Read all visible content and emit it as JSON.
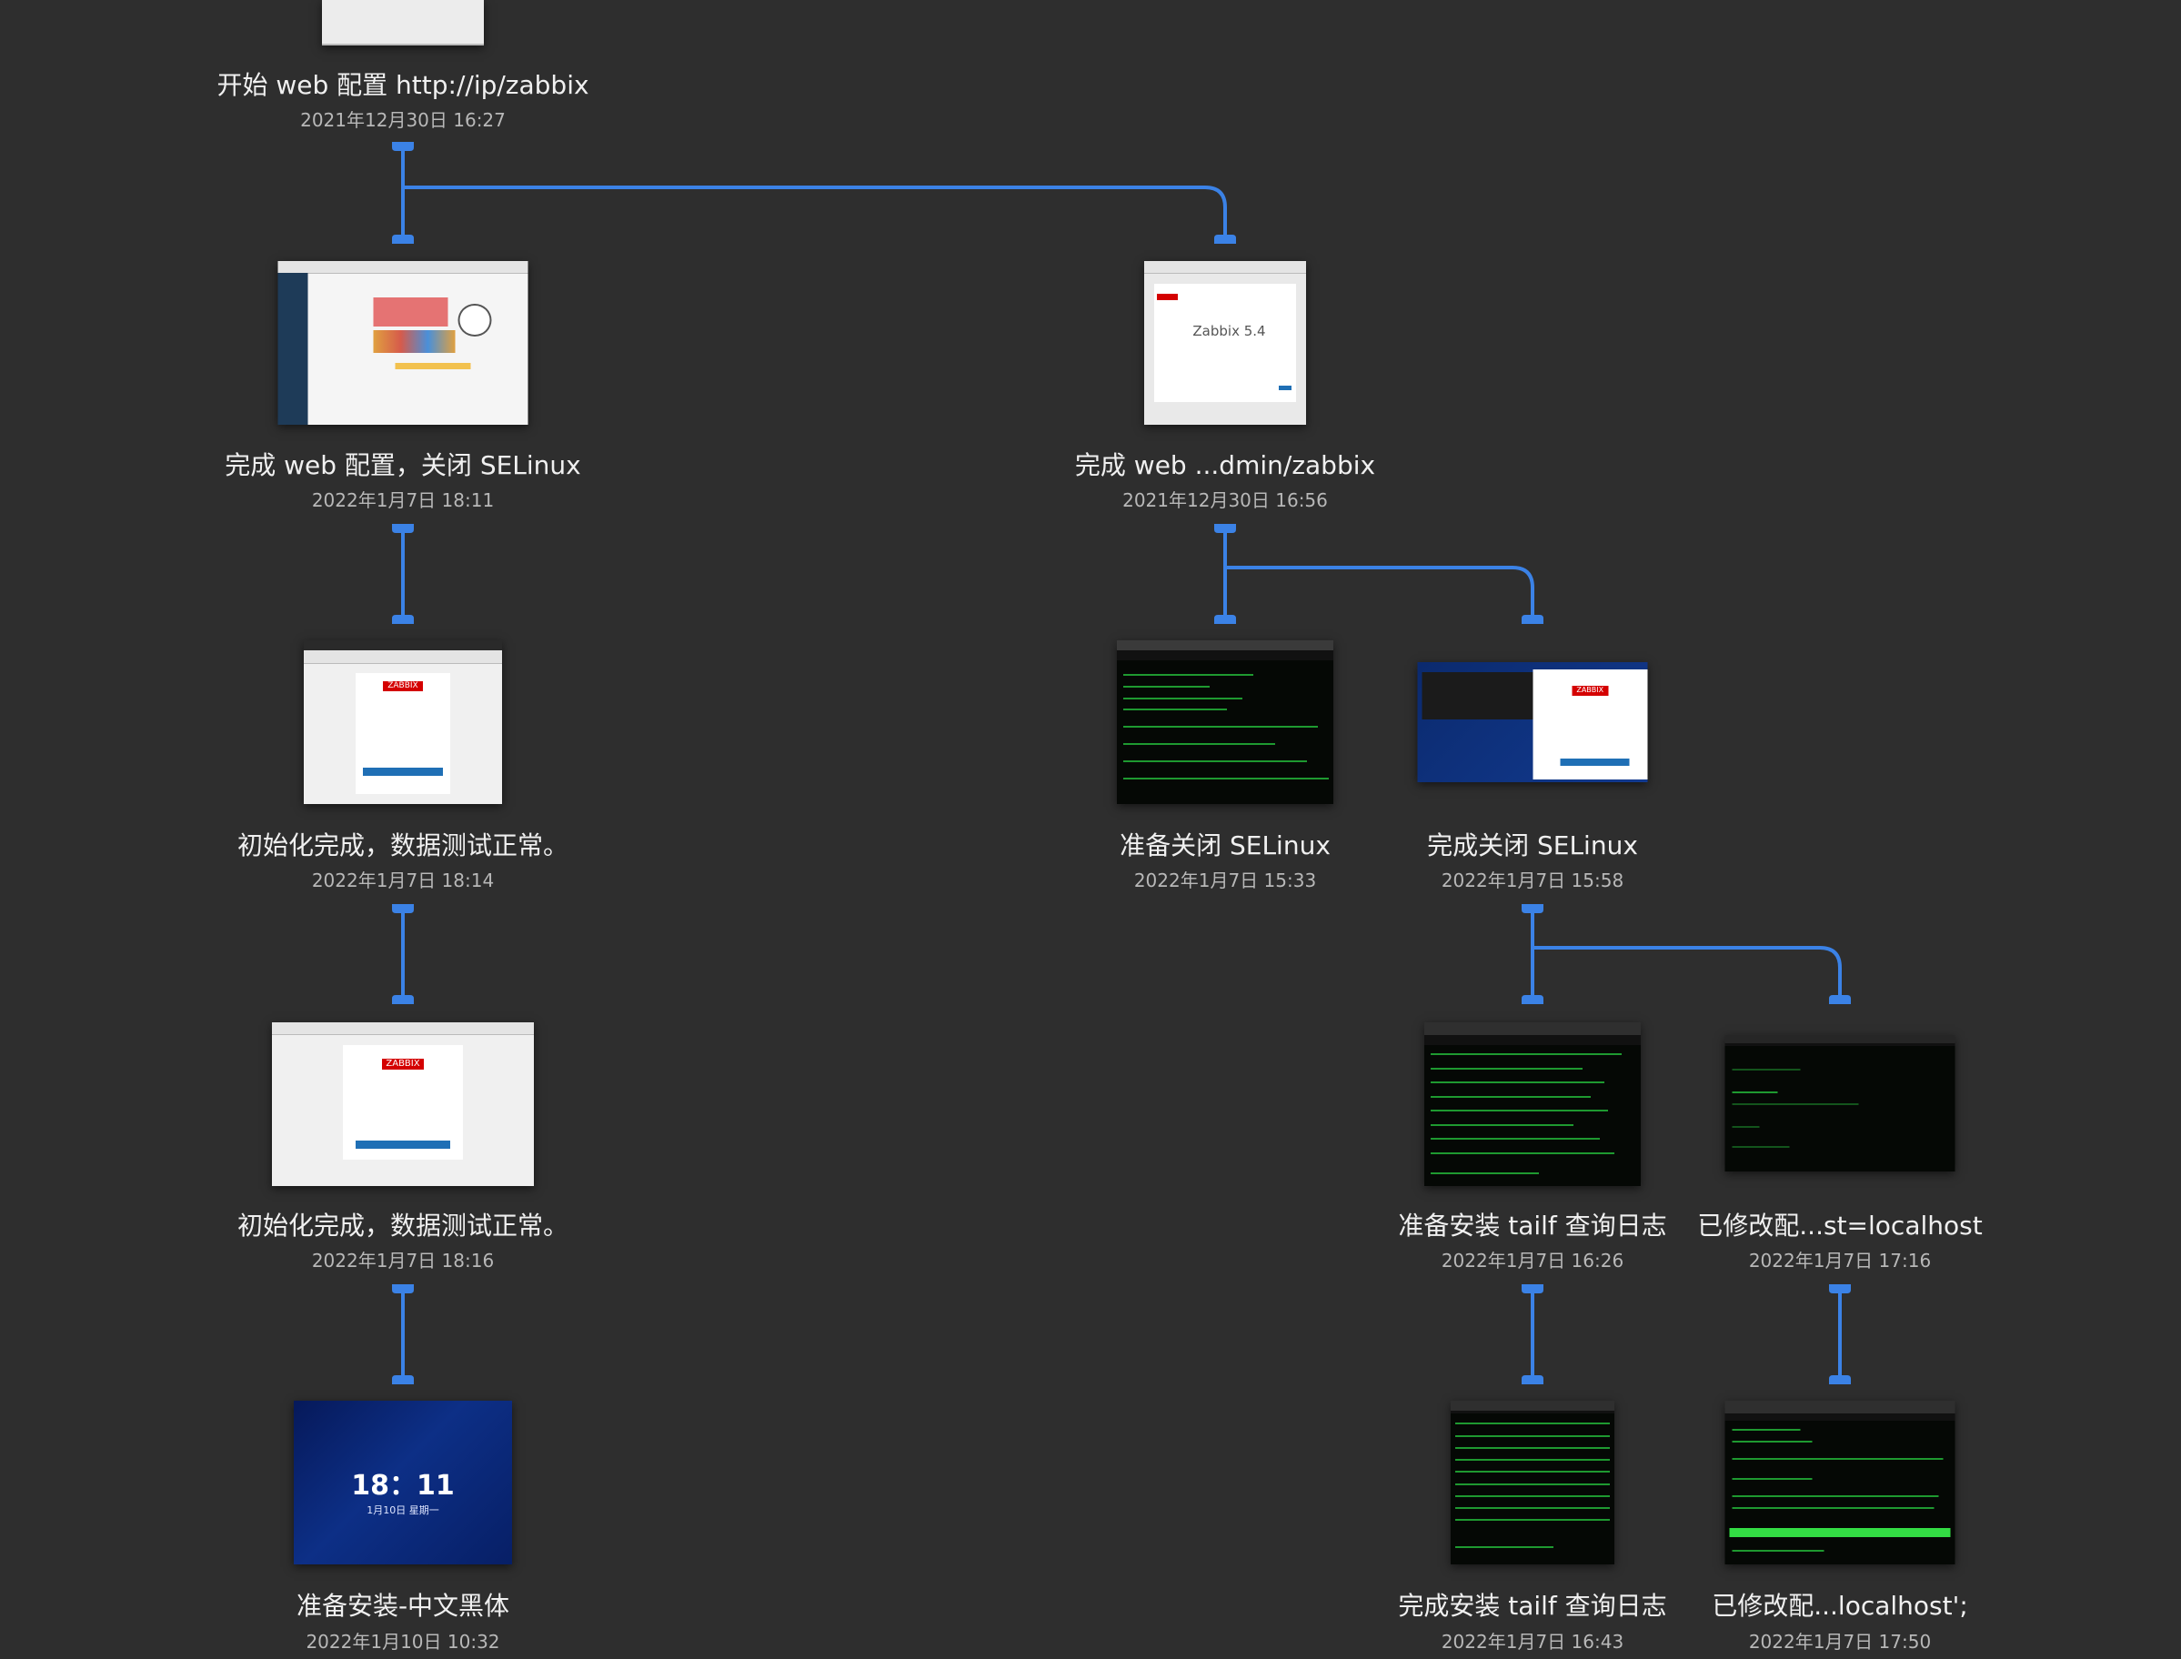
{
  "snapshots": [
    {
      "id": "n0",
      "title": "开始 web 配置 http://ip/zabbix",
      "date": "2021年12月30日 16:27",
      "thumb": "browser-blank"
    },
    {
      "id": "n1",
      "title": "完成 web 配置，关闭 SELinux",
      "date": "2022年1月7日 18:11",
      "thumb": "zabbix-dashboard"
    },
    {
      "id": "n2",
      "title": "完成 web ...dmin/zabbix",
      "date": "2021年12月30日 16:56",
      "thumb": "zabbix-setup",
      "caption": "Zabbix 5.4"
    },
    {
      "id": "n3",
      "title": "初始化完成，数据测试正常。",
      "date": "2022年1月7日 18:14",
      "thumb": "zabbix-login-desktop",
      "caption": "ZABBIX"
    },
    {
      "id": "n4",
      "title": "准备关闭 SELinux",
      "date": "2022年1月7日 15:33",
      "thumb": "terminal"
    },
    {
      "id": "n5",
      "title": "完成关闭 SELinux",
      "date": "2022年1月7日 15:58",
      "thumb": "desktop-login",
      "caption": "ZABBIX"
    },
    {
      "id": "n6",
      "title": "初始化完成，数据测试正常。",
      "date": "2022年1月7日 18:16",
      "thumb": "zabbix-login",
      "caption": "ZABBIX"
    },
    {
      "id": "n7",
      "title": "准备安装 tailf 查询日志",
      "date": "2022年1月7日 16:26",
      "thumb": "terminal-log"
    },
    {
      "id": "n8",
      "title": "已修改配...st=localhost",
      "date": "2022年1月7日 17:16",
      "thumb": "terminal-dark"
    },
    {
      "id": "n9",
      "title": "准备安装-中文黑体",
      "date": "2022年1月10日 10:32",
      "thumb": "lockscreen",
      "clock": "18：11",
      "clock_sub": "1月10日 星期一"
    },
    {
      "id": "n10",
      "title": "完成安装 tailf 查询日志",
      "date": "2022年1月7日 16:43",
      "thumb": "terminal-log"
    },
    {
      "id": "n11",
      "title": "已修改配...localhost';",
      "date": "2022年1月7日 17:50",
      "thumb": "terminal-config"
    }
  ],
  "connections": [
    [
      "n0",
      "n1"
    ],
    [
      "n0",
      "n2"
    ],
    [
      "n1",
      "n3"
    ],
    [
      "n2",
      "n4"
    ],
    [
      "n2",
      "n5"
    ],
    [
      "n3",
      "n6"
    ],
    [
      "n5",
      "n7"
    ],
    [
      "n5",
      "n8"
    ],
    [
      "n6",
      "n9"
    ],
    [
      "n7",
      "n10"
    ],
    [
      "n8",
      "n11"
    ]
  ],
  "colors": {
    "background": "#2e2e2e",
    "connector": "#3b82e6",
    "title": "#f0f0f0",
    "date": "#b8b8b8"
  }
}
